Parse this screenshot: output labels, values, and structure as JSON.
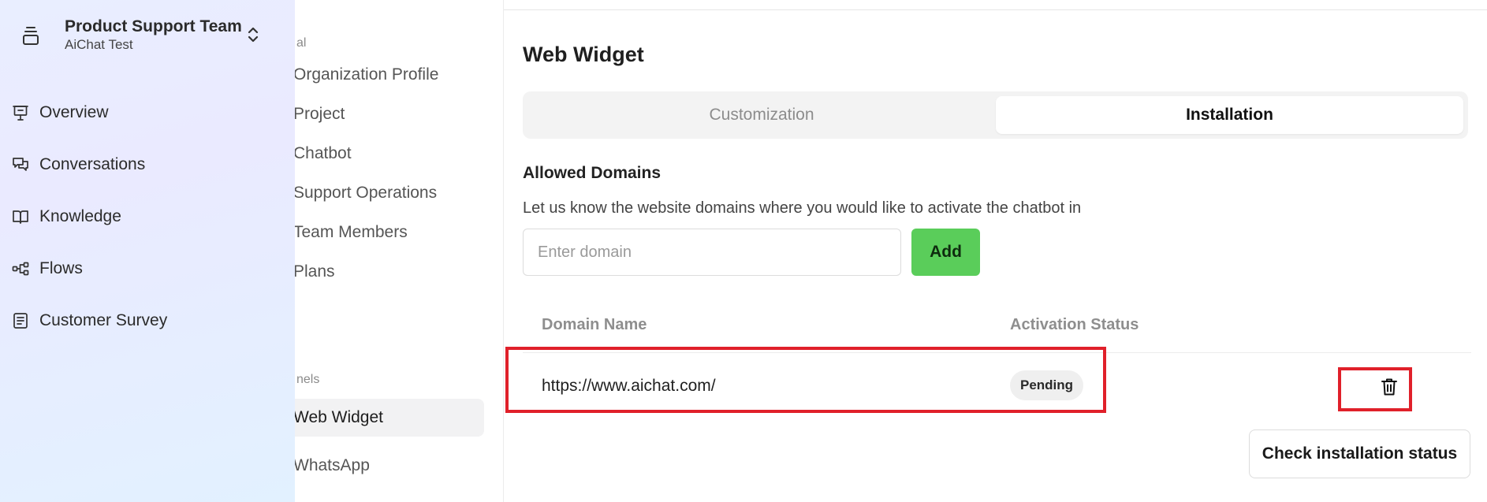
{
  "sidebar": {
    "team_name": "Product Support Team",
    "team_sub": "AiChat Test",
    "items": [
      {
        "label": "Overview",
        "icon": "presentation-icon"
      },
      {
        "label": "Conversations",
        "icon": "chat-bubbles-icon"
      },
      {
        "label": "Knowledge",
        "icon": "book-icon"
      },
      {
        "label": "Flows",
        "icon": "flow-icon"
      },
      {
        "label": "Customer Survey",
        "icon": "survey-icon"
      }
    ]
  },
  "settings_menu": {
    "section_general_partial": "al",
    "section_channels_partial": "nels",
    "items": [
      "Organization Profile",
      "Project",
      "Chatbot",
      "Support Operations",
      "Team Members",
      "Plans",
      "Web Widget",
      "WhatsApp"
    ],
    "active_item": "Web Widget"
  },
  "main": {
    "title": "Web Widget",
    "tabs": [
      {
        "label": "Customization",
        "active": false
      },
      {
        "label": "Installation",
        "active": true
      }
    ],
    "allowed_domains": {
      "title": "Allowed Domains",
      "description": "Let us know the website domains where you would like to activate the chatbot in",
      "input_placeholder": "Enter domain",
      "input_value": "",
      "add_label": "Add"
    },
    "table": {
      "headers": [
        "Domain Name",
        "Activation Status"
      ],
      "rows": [
        {
          "domain": "https://www.aichat.com/",
          "status": "Pending"
        }
      ]
    },
    "check_button_label": "Check installation status"
  },
  "colors": {
    "accent_green": "#5acd5a",
    "highlight_red": "#e0202a",
    "sidebar_bg": "#e6efff"
  }
}
